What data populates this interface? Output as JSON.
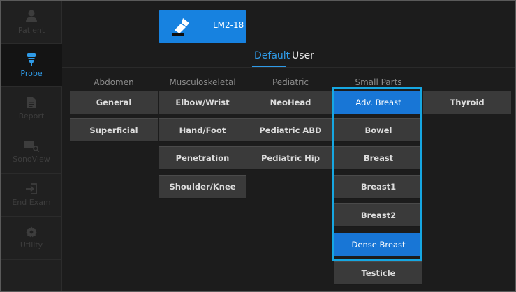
{
  "sidebar": {
    "items": [
      {
        "label": "Patient",
        "icon": "person-icon",
        "active": false
      },
      {
        "label": "Probe",
        "icon": "probe-icon",
        "active": true
      },
      {
        "label": "Report",
        "icon": "document-icon",
        "active": false
      },
      {
        "label": "SonoView",
        "icon": "image-search-icon",
        "active": false
      },
      {
        "label": "End Exam",
        "icon": "exit-icon",
        "active": false
      },
      {
        "label": "Utility",
        "icon": "gear-icon",
        "active": false
      }
    ]
  },
  "probe": {
    "label": "LM2-18",
    "icon": "transducer-icon"
  },
  "tabs": [
    {
      "label": "Default",
      "active": true
    },
    {
      "label": "User",
      "active": false
    }
  ],
  "columns": [
    {
      "header": "Abdomen",
      "presets": [
        "General",
        "Superficial"
      ]
    },
    {
      "header": "Musculoskeletal",
      "presets": [
        "Elbow/Wrist",
        "Hand/Foot",
        "Penetration",
        "Shoulder/Knee"
      ]
    },
    {
      "header": "Pediatric",
      "presets": [
        "NeoHead",
        "Pediatric ABD",
        "Pediatric Hip"
      ]
    },
    {
      "header": "Small Parts",
      "presets": [
        "Adv. Breast",
        "Bowel",
        "Breast",
        "Breast1",
        "Breast2",
        "Dense Breast",
        "Testicle"
      ]
    },
    {
      "header": "",
      "presets": [
        "Thyroid"
      ]
    }
  ],
  "selected_presets": [
    "Adv. Breast",
    "Dense Breast"
  ],
  "colors": {
    "accent": "#1782e0",
    "highlight_outline": "#16a7e2",
    "button_bg": "#3a3a3a",
    "background": "#1c1c1c"
  }
}
